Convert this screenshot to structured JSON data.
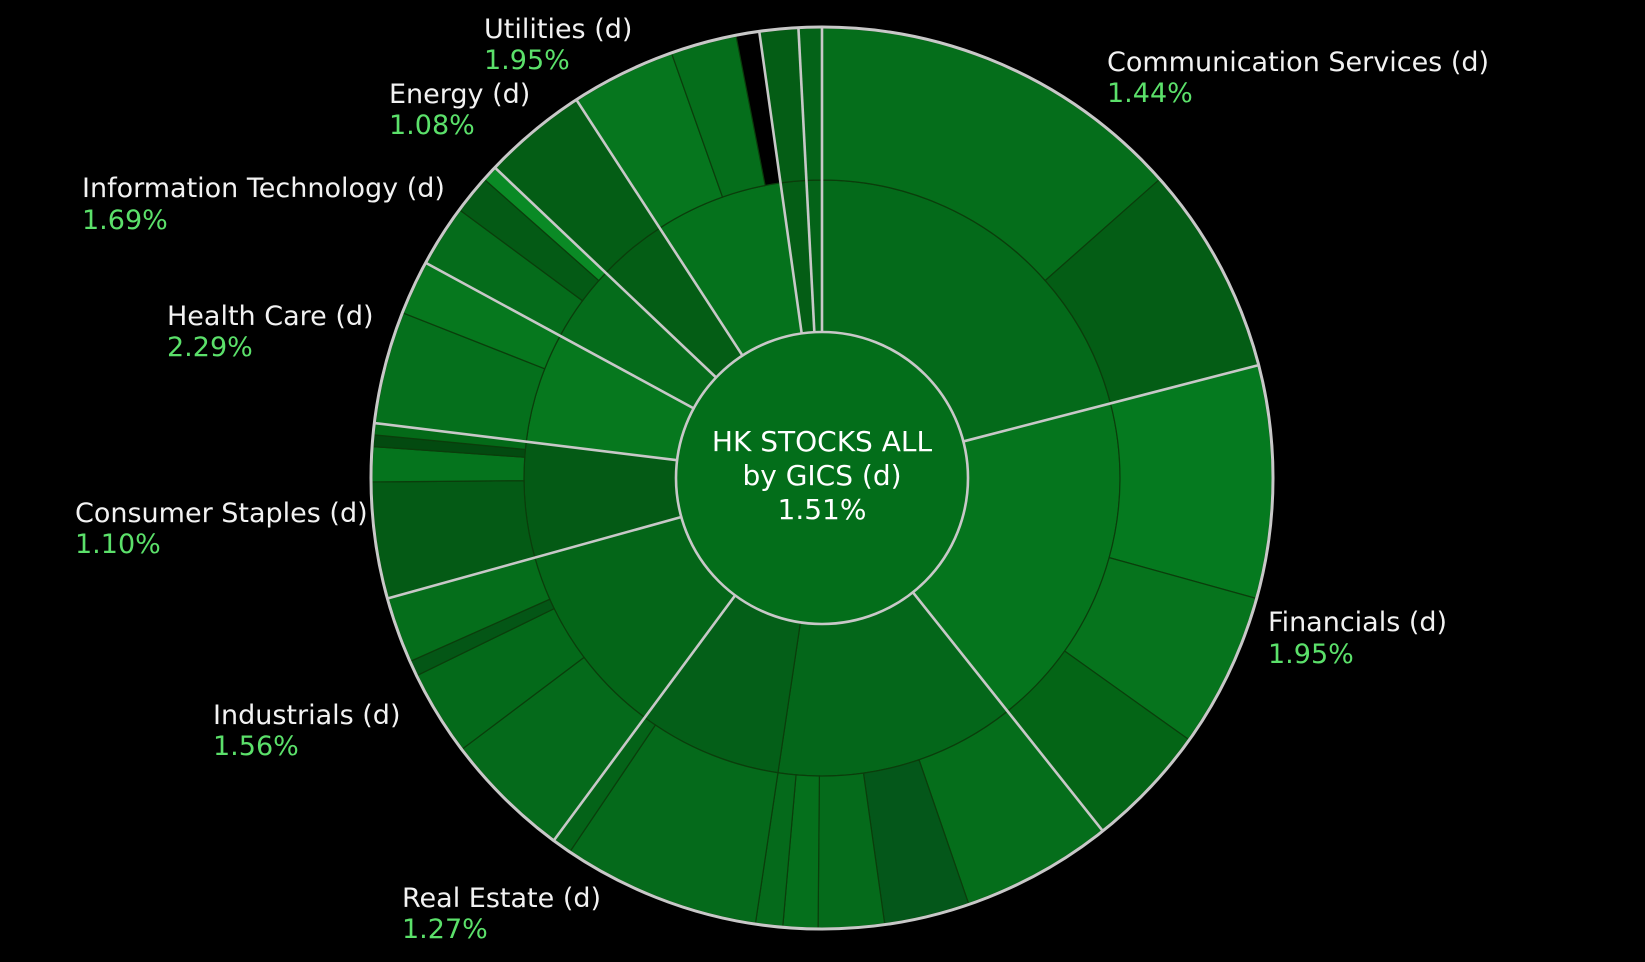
{
  "chart_data": {
    "type": "sunburst",
    "center": {
      "line1": "HK STOCKS ALL",
      "line2": "by GICS (d)",
      "value": "1.51%"
    },
    "colors": {
      "background": "#000000",
      "sector_border": "#c8c8c8",
      "inner_border": "#0b3d0b",
      "label_name": "#f2f2f2",
      "label_value": "#5be06a",
      "center_fill": "#036e1a"
    },
    "sectors": [
      {
        "id": "communication-services",
        "name": "Communication Services (d)",
        "change": "1.44%",
        "start": 0,
        "end": 75.5,
        "industries": [
          {
            "start": 0,
            "end": 75.5,
            "fill": "#046a1a",
            "subs": [
              {
                "start": 0,
                "end": 48.5,
                "fill": "#056e1b"
              },
              {
                "start": 48.5,
                "end": 75.5,
                "fill": "#045d15"
              }
            ]
          }
        ]
      },
      {
        "id": "financials",
        "name": "Financials (d)",
        "change": "1.95%",
        "start": 75.5,
        "end": 141.5,
        "industries": [
          {
            "start": 75.5,
            "end": 141.5,
            "fill": "#05751d",
            "subs": [
              {
                "start": 75.5,
                "end": 105.5,
                "fill": "#057a1f"
              },
              {
                "start": 105.5,
                "end": 125.5,
                "fill": "#06741d"
              },
              {
                "start": 125.5,
                "end": 141.5,
                "fill": "#046516"
              }
            ]
          }
        ]
      },
      {
        "id": "real-estate",
        "name": "Real Estate (d)",
        "change": "1.27%",
        "start": 141.5,
        "end": 216.5,
        "industries": [
          {
            "start": 141.5,
            "end": 188.5,
            "fill": "#04671a",
            "subs": [
              {
                "start": 141.5,
                "end": 161.0,
                "fill": "#056e1b"
              },
              {
                "start": 161.0,
                "end": 172.0,
                "fill": "#04571a"
              },
              {
                "start": 172.0,
                "end": 180.5,
                "fill": "#056b1b"
              },
              {
                "start": 180.5,
                "end": 185.0,
                "fill": "#05701c"
              },
              {
                "start": 185.0,
                "end": 188.5,
                "fill": "#056a1b"
              }
            ]
          },
          {
            "start": 188.5,
            "end": 216.5,
            "fill": "#045f18",
            "subs": [
              {
                "start": 188.5,
                "end": 214.0,
                "fill": "#056a1b"
              },
              {
                "start": 214.0,
                "end": 216.5,
                "fill": "#046318"
              }
            ]
          }
        ]
      },
      {
        "id": "industrials",
        "name": "Industrials (d)",
        "change": "1.56%",
        "start": 216.5,
        "end": 254.5,
        "industries": [
          {
            "start": 216.5,
            "end": 254.5,
            "fill": "#046618",
            "subs": [
              {
                "start": 216.5,
                "end": 233.0,
                "fill": "#056a1b"
              },
              {
                "start": 233.0,
                "end": 244.0,
                "fill": "#046a1a"
              },
              {
                "start": 244.0,
                "end": 246.0,
                "fill": "#045616"
              },
              {
                "start": 246.0,
                "end": 254.5,
                "fill": "#056e1b"
              }
            ]
          }
        ]
      },
      {
        "id": "consumer-staples",
        "name": "Consumer Staples (d)",
        "change": "1.10%",
        "start": 254.5,
        "end": 277.0,
        "industries": [
          {
            "start": 254.5,
            "end": 277.0,
            "fill": "#045a15",
            "subs": [
              {
                "start": 254.5,
                "end": 269.5,
                "fill": "#045a15"
              },
              {
                "start": 269.5,
                "end": 274.0,
                "fill": "#05741d"
              },
              {
                "start": 274.0,
                "end": 275.5,
                "fill": "#034a10"
              },
              {
                "start": 275.5,
                "end": 277.0,
                "fill": "#046a18"
              }
            ]
          }
        ]
      },
      {
        "id": "health-care",
        "name": "Health Care (d)",
        "change": "2.29%",
        "start": 277.0,
        "end": 298.5,
        "industries": [
          {
            "start": 277.0,
            "end": 298.5,
            "fill": "#06781e",
            "subs": [
              {
                "start": 277.0,
                "end": 291.5,
                "fill": "#05701c"
              },
              {
                "start": 291.5,
                "end": 298.5,
                "fill": "#06781e"
              }
            ]
          }
        ]
      },
      {
        "id": "information-technology",
        "name": "Information Technology (d)",
        "change": "1.69%",
        "start": 298.5,
        "end": 313.5,
        "industries": [
          {
            "start": 298.5,
            "end": 313.5,
            "fill": "#056c1b",
            "subs": [
              {
                "start": 298.5,
                "end": 306.5,
                "fill": "#056c1b"
              },
              {
                "start": 306.5,
                "end": 311.5,
                "fill": "#045a15"
              },
              {
                "start": 311.5,
                "end": 313.5,
                "fill": "#0a8a25"
              }
            ]
          }
        ]
      },
      {
        "id": "energy",
        "name": "Energy (d)",
        "change": "1.08%",
        "start": 313.5,
        "end": 327.0,
        "industries": [
          {
            "start": 313.5,
            "end": 327.0,
            "fill": "#045d15",
            "subs": [
              {
                "start": 313.5,
                "end": 327.0,
                "fill": "#045d15"
              }
            ]
          }
        ]
      },
      {
        "id": "utilities",
        "name": "Utilities (d)",
        "change": "1.95%",
        "start": 327.0,
        "end": 352.0,
        "industries": [
          {
            "start": 327.0,
            "end": 352.0,
            "fill": "#05721c",
            "subs": [
              {
                "start": 327.0,
                "end": 340.5,
                "fill": "#06761e"
              },
              {
                "start": 340.5,
                "end": 349.0,
                "fill": "#056e1b"
              }
            ]
          }
        ]
      },
      {
        "id": "other-1",
        "name": "",
        "change": "",
        "start": 352.0,
        "end": 357.0,
        "industries": [
          {
            "start": 352.0,
            "end": 357.0,
            "fill": "#045d15",
            "subs": [
              {
                "start": 352.0,
                "end": 357.0,
                "fill": "#045d15"
              }
            ]
          }
        ]
      },
      {
        "id": "other-2",
        "name": "",
        "change": "",
        "start": 357.0,
        "end": 360.0,
        "industries": [
          {
            "start": 357.0,
            "end": 360.0,
            "fill": "#046318",
            "subs": [
              {
                "start": 357.0,
                "end": 360.0,
                "fill": "#046318"
              }
            ]
          }
        ]
      }
    ]
  }
}
